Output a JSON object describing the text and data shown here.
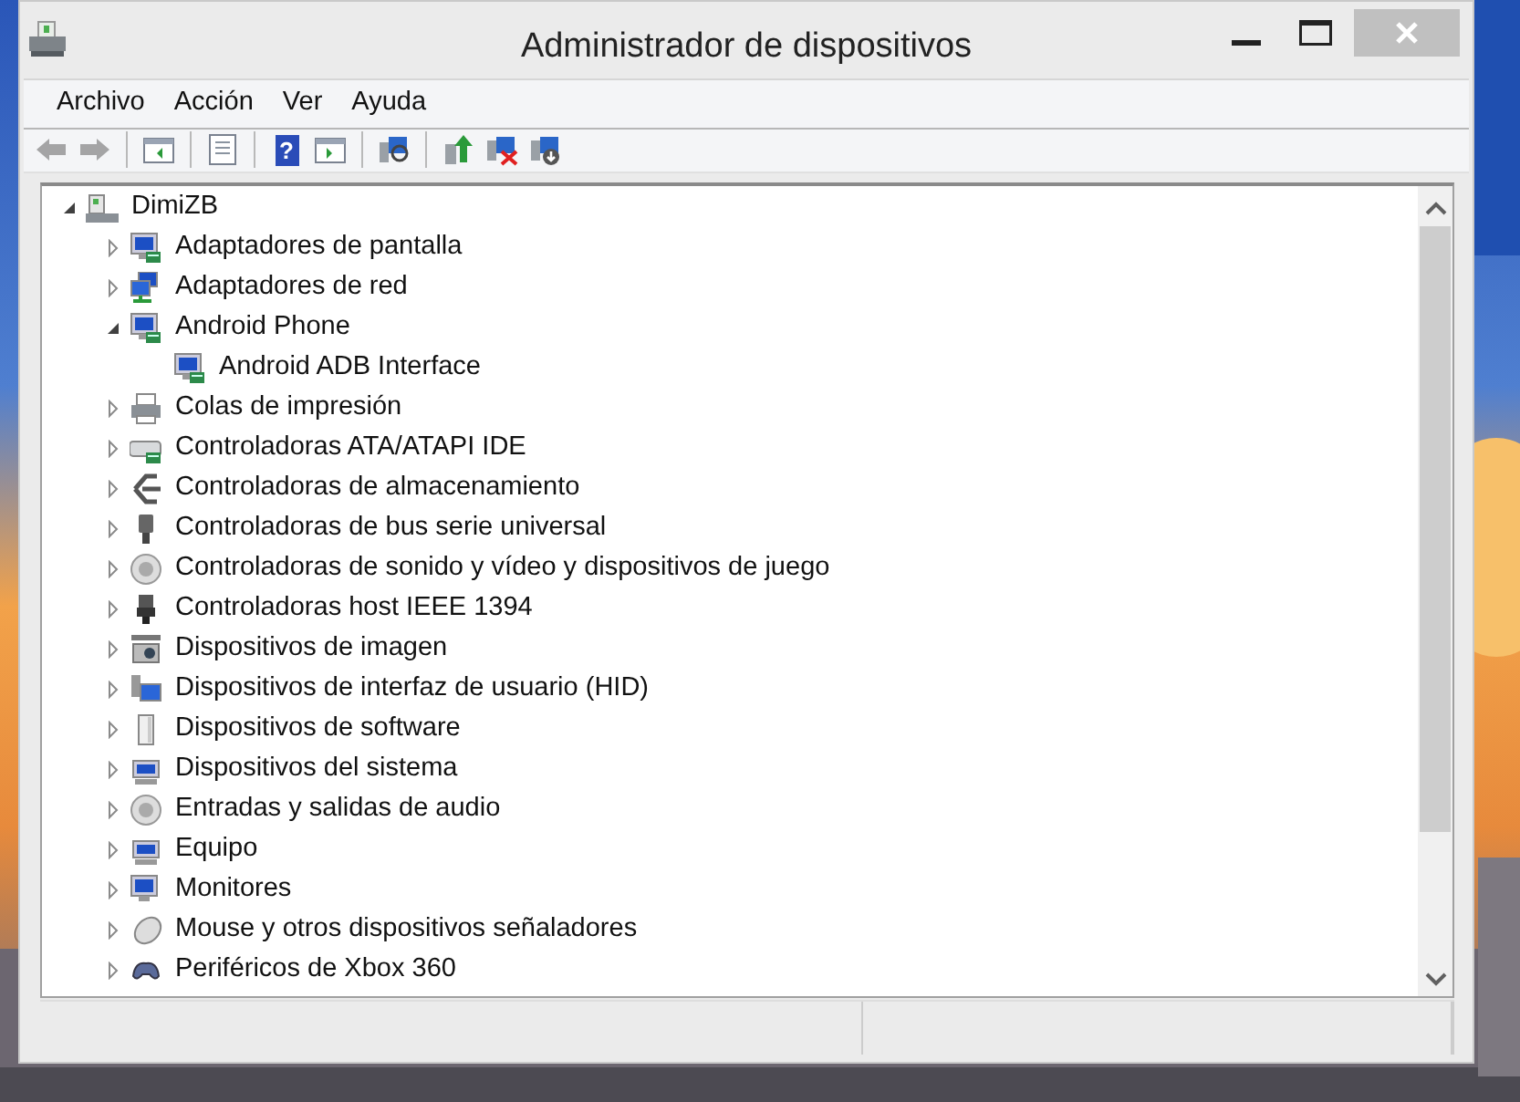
{
  "window": {
    "title": "Administrador de dispositivos"
  },
  "menu": [
    {
      "label": "Archivo"
    },
    {
      "label": "Acción"
    },
    {
      "label": "Ver"
    },
    {
      "label": "Ayuda"
    }
  ],
  "toolbar": [
    {
      "kind": "back",
      "disabled": true
    },
    {
      "kind": "forward",
      "disabled": true
    },
    {
      "kind": "separator"
    },
    {
      "kind": "console-tree",
      "disabled": false
    },
    {
      "kind": "separator"
    },
    {
      "kind": "properties",
      "disabled": false
    },
    {
      "kind": "separator"
    },
    {
      "kind": "help",
      "disabled": false,
      "glyph": "?"
    },
    {
      "kind": "action-pane",
      "disabled": false
    },
    {
      "kind": "separator"
    },
    {
      "kind": "scan",
      "disabled": false
    },
    {
      "kind": "separator"
    },
    {
      "kind": "update",
      "disabled": false
    },
    {
      "kind": "uninstall",
      "disabled": false
    },
    {
      "kind": "disable",
      "disabled": false
    }
  ],
  "tree": {
    "label": "DimiZB",
    "expanded": true,
    "children": [
      {
        "label": "Adaptadores de pantalla",
        "expanded": false
      },
      {
        "label": "Adaptadores de red",
        "expanded": false
      },
      {
        "label": "Android Phone",
        "expanded": true,
        "children": [
          {
            "label": "Android ADB Interface"
          }
        ]
      },
      {
        "label": "Colas de impresión",
        "expanded": false
      },
      {
        "label": "Controladoras ATA/ATAPI IDE",
        "expanded": false
      },
      {
        "label": "Controladoras de almacenamiento",
        "expanded": false
      },
      {
        "label": "Controladoras de bus serie universal",
        "expanded": false
      },
      {
        "label": "Controladoras de sonido y vídeo y dispositivos de juego",
        "expanded": false
      },
      {
        "label": "Controladoras host IEEE 1394",
        "expanded": false
      },
      {
        "label": "Dispositivos de imagen",
        "expanded": false
      },
      {
        "label": "Dispositivos de interfaz de usuario (HID)",
        "expanded": false
      },
      {
        "label": "Dispositivos de software",
        "expanded": false
      },
      {
        "label": "Dispositivos del sistema",
        "expanded": false
      },
      {
        "label": "Entradas y salidas de audio",
        "expanded": false
      },
      {
        "label": "Equipo",
        "expanded": false
      },
      {
        "label": "Monitores",
        "expanded": false
      },
      {
        "label": "Mouse y otros dispositivos señaladores",
        "expanded": false
      },
      {
        "label": "Periféricos de Xbox 360",
        "expanded": false
      }
    ]
  }
}
